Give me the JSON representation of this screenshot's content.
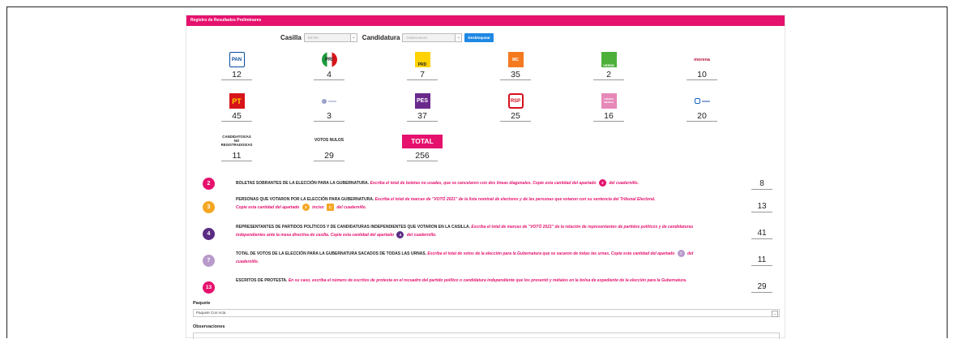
{
  "header": {
    "title": "Registro de Resultados Preliminares"
  },
  "filters": {
    "casilla_label": "Casilla",
    "casilla_value": "B3780",
    "candidatura_label": "Candidatura",
    "candidatura_value": "Gubernatura",
    "unlock_label": "Desbloquear"
  },
  "parties": [
    {
      "logo": "PAN",
      "value": "12",
      "color": "#0a4a9e"
    },
    {
      "logo": "PRI",
      "value": "4",
      "color": "#1a9a3c"
    },
    {
      "logo": "PRD",
      "value": "7",
      "color": "#ffd200"
    },
    {
      "logo": "MC",
      "value": "35",
      "color": "#f47a20"
    },
    {
      "logo": "VERDE",
      "value": "2",
      "color": "#4cb03a"
    },
    {
      "logo": "morena",
      "value": "10",
      "color": "#b5123a"
    },
    {
      "logo": "PT",
      "value": "45",
      "color": "#d7141a"
    },
    {
      "logo": "",
      "value": "3",
      "color": "#9aa2c8"
    },
    {
      "logo": "PES",
      "value": "37",
      "color": "#6a2a8c"
    },
    {
      "logo": "RSP",
      "value": "25",
      "color": "#d5101f"
    },
    {
      "logo": "FUERZA MÉXICO",
      "value": "16",
      "color": "#e689b8"
    },
    {
      "logo": "",
      "value": "20",
      "color": "#1565c0"
    }
  ],
  "extras": {
    "cnr_label": "CANDIDATOS/AS NO REGISTRADOS/AS",
    "cnr_value": "11",
    "nulos_label": "VOTOS NULOS",
    "nulos_value": "29",
    "total_label": "TOTAL",
    "total_value": "256"
  },
  "rows": [
    {
      "num": "2",
      "color": "#e5116d",
      "title": "BOLETAS SOBRANTES DE LA ELECCIÓN PARA LA GUBERNATURA.",
      "desc": "Escriba el total de boletas no usadas, que se cancelaron con dos líneas diagonales.",
      "copy": "Copie esta cantidad del apartado",
      "ref": "2",
      "tail": "del cuadernillo.",
      "value": "8"
    },
    {
      "num": "3",
      "color": "#f5a623",
      "title": "PERSONAS QUE VOTARON POR LA ELECCIÓN PARA GUBERNATURA.",
      "desc": "Escriba el total de marcas de \"VOTÓ 2021\" de la lista nominal de electores y de las personas que votaron con su sentencia del Tribunal Electoral.",
      "copy": "Copie esta cantidad del apartado",
      "ref": "3",
      "inciso": "inciso",
      "ref2": "C",
      "tail": "del cuadernillo.",
      "value": "13"
    },
    {
      "num": "4",
      "color": "#5b2c83",
      "title": "REPRESENTANTES DE PARTIDOS POLÍTICOS Y DE CANDIDATURAS INDEPENDIENTES QUE VOTARON EN LA CASILLA.",
      "desc": "Escriba el total de marcas de \"VOTÓ 2021\" de la relación de representantes de partidos políticos y de candidaturas independientes ante la mesa directiva de casilla.",
      "copy": "Copie esta cantidad del apartado",
      "ref": "4",
      "tail": "del cuadernillo.",
      "value": "41"
    },
    {
      "num": "7",
      "color": "#b89acb",
      "title": "TOTAL DE VOTOS DE LA ELECCIÓN PARA LA GUBERNATURA SACADOS DE TODAS LAS URNAS.",
      "desc": "Escriba el total de votos de la elección para la Gubernatura que se sacaron de todas las urnas.",
      "copy": "Copie esta cantidad del apartado",
      "ref": "7",
      "tail": "del cuadernillo.",
      "value": "11"
    },
    {
      "num": "13",
      "color": "#e5116d",
      "title": "ESCRITOS DE PROTESTA.",
      "desc": "En su caso, escriba el número de escritos de protesta en el recuadro del partido político o candidatura independiente que los presentó y métalos en la bolsa de expediente de la elección para la Gubernatura.",
      "value": "29"
    }
  ],
  "paquete": {
    "label": "Paquete",
    "value": "Paquete Con Acta"
  },
  "observaciones": {
    "label": "Observaciones",
    "value": ""
  }
}
